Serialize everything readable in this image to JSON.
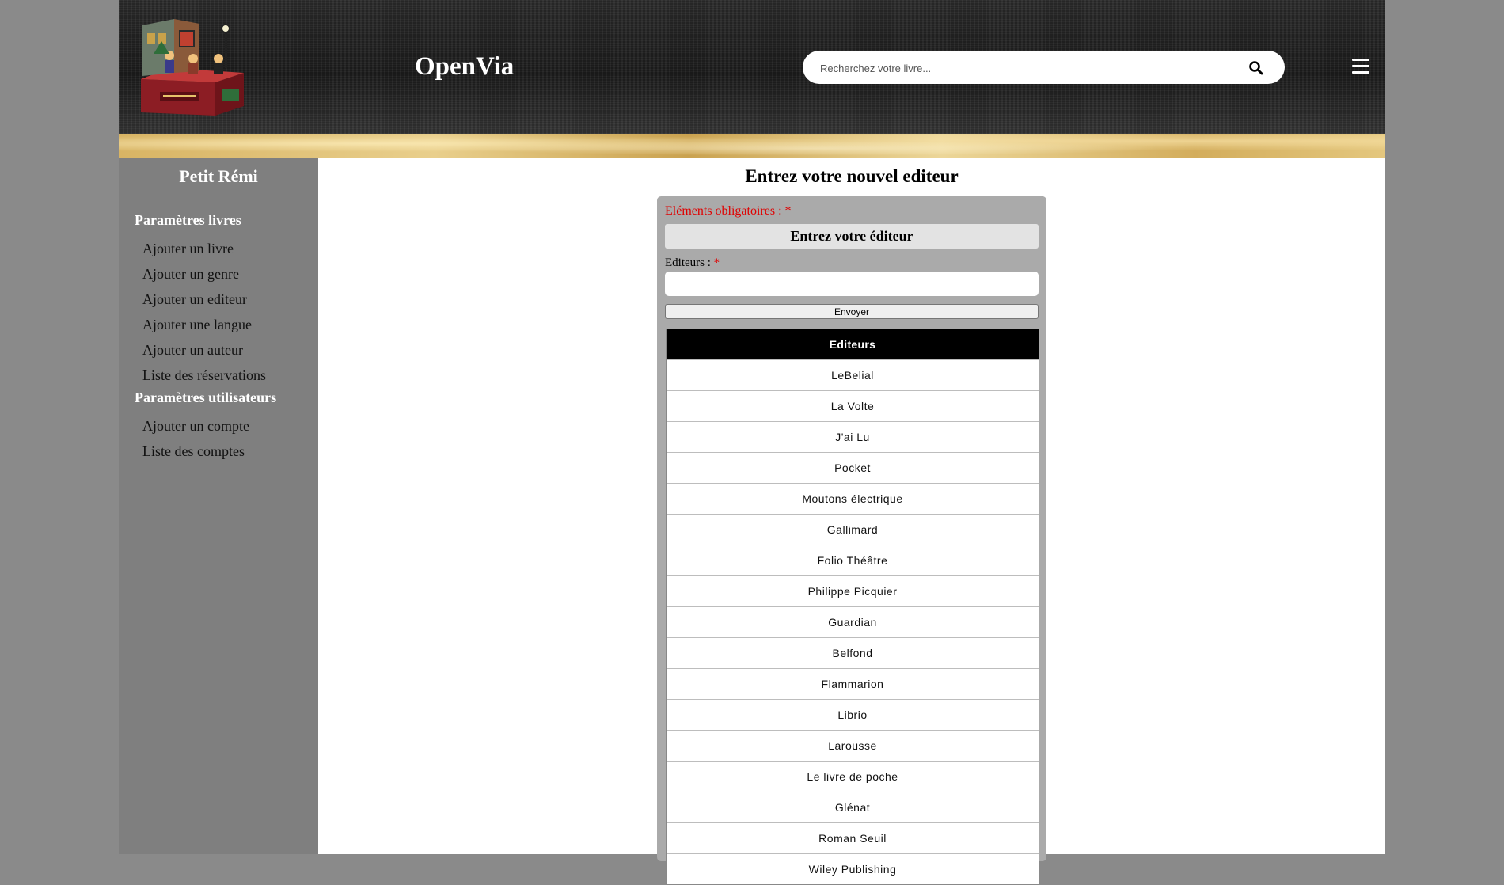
{
  "header": {
    "brand": "OpenVia",
    "search_placeholder": "Recherchez votre livre...",
    "icons": {
      "search": "search-icon",
      "menu": "hamburger-menu-icon",
      "logo": "christmas-carol-diorama-logo"
    }
  },
  "sidebar": {
    "user_name": "Petit Rémi",
    "sections": [
      {
        "title": "Paramètres livres",
        "items": [
          "Ajouter un livre",
          "Ajouter un genre",
          "Ajouter un editeur",
          "Ajouter une langue",
          "Ajouter un auteur",
          "Liste des réservations"
        ]
      },
      {
        "title": "Paramètres utilisateurs",
        "items": [
          "Ajouter un compte",
          "Liste des comptes"
        ]
      }
    ]
  },
  "main": {
    "title": "Entrez votre nouvel editeur",
    "required_note": "Eléments obligatoires : *",
    "form_header": "Entrez votre éditeur",
    "field_label": "Editeurs : ",
    "field_required_mark": "*",
    "field_value": "",
    "submit_label": "Envoyer",
    "table": {
      "header": "Editeurs",
      "rows": [
        "LeBelial",
        "La Volte",
        "J'ai Lu",
        "Pocket",
        "Moutons électrique",
        "Gallimard",
        "Folio Théâtre",
        "Philippe Picquier",
        "Guardian",
        "Belfond",
        "Flammarion",
        "Librio",
        "Larousse",
        "Le livre de poche",
        "Glénat",
        "Roman Seuil",
        "Wiley Publishing"
      ]
    }
  },
  "colors": {
    "page_bg": "#8a8a8a",
    "sidebar_bg": "#7f7f7f",
    "required_red": "#e00000",
    "table_header_bg": "#000000"
  }
}
